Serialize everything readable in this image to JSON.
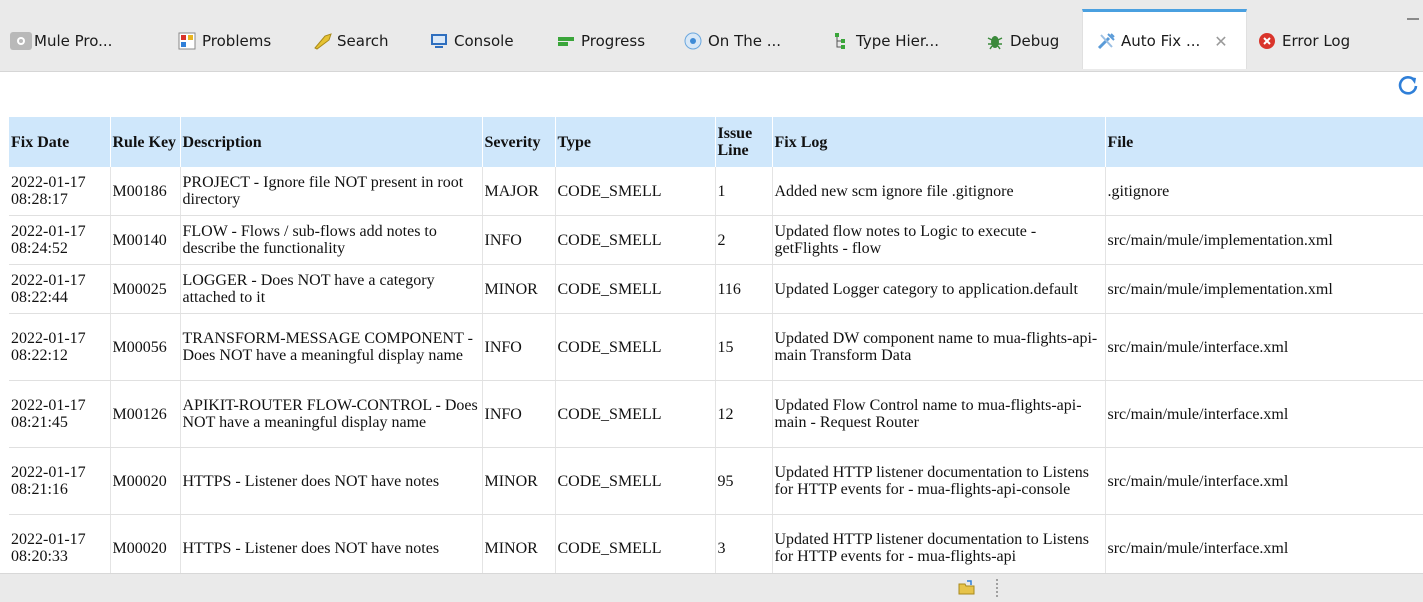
{
  "tabs": [
    {
      "label": "Mule Pro...",
      "icon": "mule-properties-icon"
    },
    {
      "label": "Problems",
      "icon": "problems-icon"
    },
    {
      "label": "Search",
      "icon": "search-icon"
    },
    {
      "label": "Console",
      "icon": "console-icon"
    },
    {
      "label": "Progress",
      "icon": "progress-icon"
    },
    {
      "label": "On The ...",
      "icon": "on-the-icon"
    },
    {
      "label": "Type Hier...",
      "icon": "type-hierarchy-icon"
    },
    {
      "label": "Debug",
      "icon": "debug-icon"
    },
    {
      "label": "Auto Fix ...",
      "icon": "auto-fix-icon",
      "active": true,
      "close": "✕"
    },
    {
      "label": "Error Log",
      "icon": "error-log-icon"
    }
  ],
  "toolbar": {
    "refresh_icon": "refresh-icon"
  },
  "table": {
    "headers": {
      "fix_date": "Fix Date",
      "rule_key": "Rule Key",
      "description": "Description",
      "severity": "Severity",
      "type": "Type",
      "issue_line": "Issue Line",
      "fix_log": "Fix Log",
      "file": "File"
    },
    "rows": [
      {
        "fix_date": "2022-01-17 08:28:17",
        "rule_key": "M00186",
        "description": "PROJECT - Ignore file NOT present in root directory",
        "severity": "MAJOR",
        "type": "CODE_SMELL",
        "issue_line": "1",
        "fix_log": "Added new scm ignore file .gitignore",
        "file": ".gitignore"
      },
      {
        "fix_date": "2022-01-17 08:24:52",
        "rule_key": "M00140",
        "description": "FLOW - Flows / sub-flows add notes to describe the functionality",
        "severity": "INFO",
        "type": "CODE_SMELL",
        "issue_line": "2",
        "fix_log": "Updated flow notes to Logic to execute - getFlights - flow",
        "file": "src/main/mule/implementation.xml"
      },
      {
        "fix_date": "2022-01-17 08:22:44",
        "rule_key": "M00025",
        "description": "LOGGER - Does NOT have a category attached to it",
        "severity": "MINOR",
        "type": "CODE_SMELL",
        "issue_line": "116",
        "fix_log": "Updated Logger category to application.default",
        "file": "src/main/mule/implementation.xml"
      },
      {
        "fix_date": "2022-01-17 08:22:12",
        "rule_key": "M00056",
        "description": "TRANSFORM-MESSAGE COMPONENT - Does NOT have a meaningful display name",
        "severity": "INFO",
        "type": "CODE_SMELL",
        "issue_line": "15",
        "fix_log": "Updated DW component name to mua-flights-api-main Transform Data",
        "file": "src/main/mule/interface.xml"
      },
      {
        "fix_date": "2022-01-17 08:21:45",
        "rule_key": "M00126",
        "description": "APIKIT-ROUTER FLOW-CONTROL - Does NOT have a meaningful display name",
        "severity": "INFO",
        "type": "CODE_SMELL",
        "issue_line": "12",
        "fix_log": "Updated Flow Control name to mua-flights-api-main - Request Router",
        "file": "src/main/mule/interface.xml"
      },
      {
        "fix_date": "2022-01-17 08:21:16",
        "rule_key": "M00020",
        "description": "HTTPS - Listener does NOT have notes",
        "severity": "MINOR",
        "type": "CODE_SMELL",
        "issue_line": "95",
        "fix_log": "Updated HTTP listener documentation to Listens for HTTP events for - mua-flights-api-console",
        "file": "src/main/mule/interface.xml"
      },
      {
        "fix_date": "2022-01-17 08:20:33",
        "rule_key": "M00020",
        "description": "HTTPS - Listener does NOT have notes",
        "severity": "MINOR",
        "type": "CODE_SMELL",
        "issue_line": "3",
        "fix_log": "Updated HTTP listener documentation to Listens for HTTP events for - mua-flights-api",
        "file": "src/main/mule/interface.xml"
      }
    ]
  },
  "statusbar": {
    "icon": "open-folder-icon"
  }
}
